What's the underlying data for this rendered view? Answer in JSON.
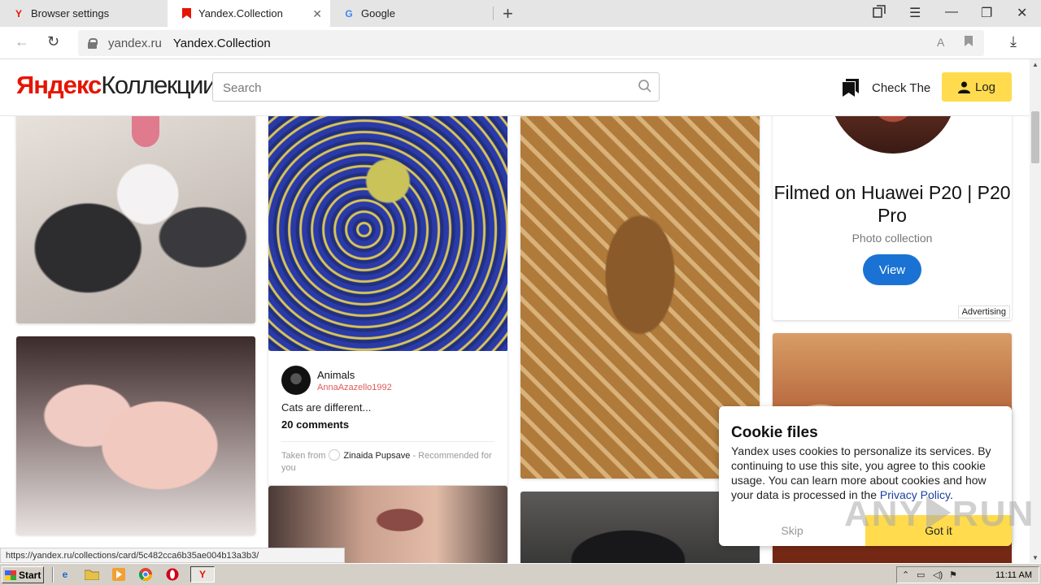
{
  "browser": {
    "tabs": [
      {
        "label": "Browser settings",
        "favicon": "Y"
      },
      {
        "label": "Yandex.Collection",
        "favicon": "bookmark"
      },
      {
        "label": "Google",
        "favicon": "G"
      }
    ],
    "address": {
      "domain": "yandex.ru",
      "title": "Yandex.Collection"
    }
  },
  "header": {
    "logo_brand": "Яндекс",
    "logo_product": "Коллекции",
    "search_placeholder": "Search",
    "check_label": "Check The",
    "login_label": "Log"
  },
  "post": {
    "board_name": "Animals",
    "username": "AnnaAzazello1992",
    "description": "Cats are different...",
    "comments": "20 comments",
    "taken_from_label": "Taken from",
    "taken_from_user": "Zinaida Pupsave",
    "recommended": "- Recommended for you"
  },
  "ad": {
    "title": "Filmed on Huawei P20 | P20 Pro",
    "subtitle": "Photo collection",
    "button": "View",
    "badge": "Advertising"
  },
  "cookie": {
    "title": "Cookie files",
    "text": "Yandex uses cookies to personalize its services. By continuing to use this site, you agree to this cookie usage. You can learn more about cookies and how your data is processed in the",
    "policy_link": "Privacy Policy",
    "text_end": ".",
    "skip": "Skip",
    "accept": "Got it"
  },
  "status_url": "https://yandex.ru/collections/card/5c482cca6b35ae004b13a3b3/",
  "watermark": {
    "left": "ANY",
    "right": "RUN"
  },
  "taskbar": {
    "start": "Start",
    "clock": "11:11 AM"
  },
  "colors": {
    "accent_yellow": "#ffdb4d",
    "brand_red": "#e61400",
    "view_blue": "#1a73d4"
  }
}
